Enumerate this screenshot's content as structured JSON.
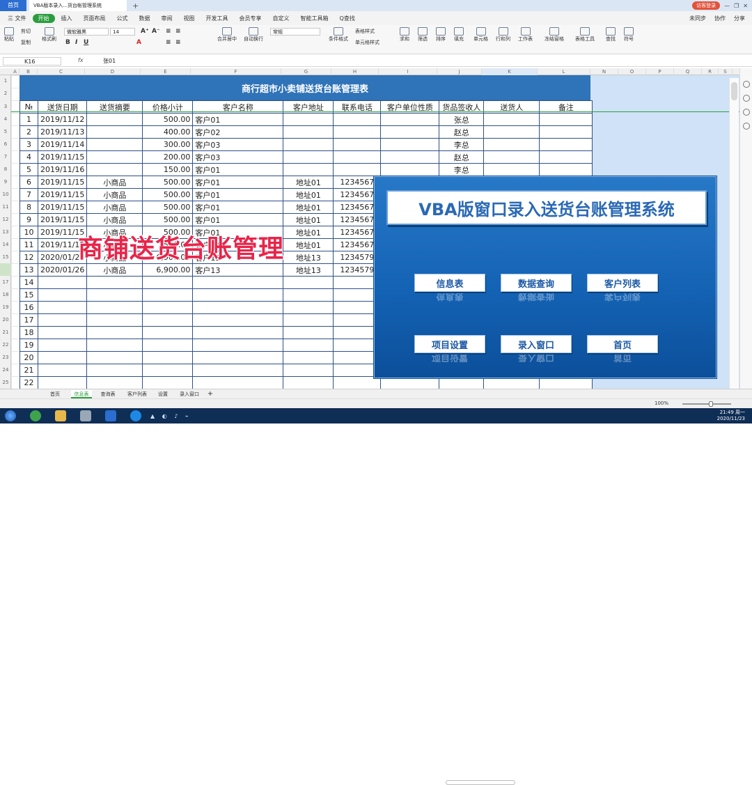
{
  "tabs": {
    "home": "首页",
    "document": "VBA版本录入...货台帐管理系统"
  },
  "login": "访客登录",
  "menu": {
    "file": "三 文件",
    "items": [
      "开始",
      "插入",
      "页面布局",
      "公式",
      "数据",
      "审阅",
      "视图",
      "开发工具",
      "会员专享",
      "自定义",
      "智能工具箱"
    ],
    "search": "Q查找",
    "right": [
      "未同步",
      "协作",
      "分享"
    ]
  },
  "ribbon": {
    "cut": "剪切",
    "paste": "粘贴",
    "copy": "复制",
    "format_painter": "格式刷",
    "font_name": "微软雅黑",
    "font_size": "14",
    "number_format": "常规",
    "merge": "合并居中",
    "wrap": "自动换行",
    "table_style": "表格样式",
    "cond_format": "条件格式",
    "cell_style": "单元格样式",
    "sum": "求和",
    "filter": "筛选",
    "sort": "排序",
    "fill": "填充",
    "cell": "单元格",
    "rowcol": "行和列",
    "worksheet": "工作表",
    "freeze": "冻结窗格",
    "table_tools": "表格工具",
    "find": "查找",
    "symbol": "符号"
  },
  "formula": {
    "cell_ref": "K16",
    "fx": "fx",
    "value": "张01"
  },
  "columns": [
    "A",
    "B",
    "C",
    "D",
    "E",
    "F",
    "G",
    "H",
    "I",
    "J",
    "K",
    "L",
    "N",
    "O",
    "P",
    "Q",
    "R",
    "S"
  ],
  "rows": [
    "1",
    "2",
    "3",
    "4",
    "5",
    "6",
    "7",
    "8",
    "9",
    "10",
    "11",
    "12",
    "13",
    "14",
    "15",
    "16",
    "17",
    "18",
    "19",
    "20",
    "21",
    "22",
    "23",
    "24",
    "25"
  ],
  "sheet": {
    "title": "商行超市小卖铺送货台账管理表",
    "headers": [
      "№",
      "送货日期",
      "送货摘要",
      "价格小计",
      "客户名称",
      "客户地址",
      "联系电话",
      "客户单位性质",
      "货品签收人",
      "送货人",
      "备注"
    ],
    "rows": [
      [
        "1",
        "2019/11/12",
        "",
        "500.00",
        "客户01",
        "",
        "",
        "",
        "张总",
        "",
        ""
      ],
      [
        "2",
        "2019/11/13",
        "",
        "400.00",
        "客户02",
        "",
        "",
        "",
        "赵总",
        "",
        ""
      ],
      [
        "3",
        "2019/11/14",
        "",
        "300.00",
        "客户03",
        "",
        "",
        "",
        "李总",
        "",
        ""
      ],
      [
        "4",
        "2019/11/15",
        "",
        "200.00",
        "客户03",
        "",
        "",
        "",
        "赵总",
        "",
        ""
      ],
      [
        "5",
        "2019/11/16",
        "",
        "150.00",
        "客户01",
        "",
        "",
        "",
        "李总",
        "",
        ""
      ],
      [
        "6",
        "2019/11/15",
        "小商品",
        "500.00",
        "客户01",
        "地址01",
        "1234567",
        "",
        "",
        "",
        ""
      ],
      [
        "7",
        "2019/11/15",
        "小商品",
        "500.00",
        "客户01",
        "地址01",
        "1234567",
        "",
        "",
        "",
        ""
      ],
      [
        "8",
        "2019/11/15",
        "小商品",
        "500.00",
        "客户01",
        "地址01",
        "1234567",
        "",
        "",
        "",
        ""
      ],
      [
        "9",
        "2019/11/15",
        "小商品",
        "500.00",
        "客户01",
        "地址01",
        "1234567",
        "",
        "",
        "",
        ""
      ],
      [
        "10",
        "2019/11/15",
        "小商品",
        "500.00",
        "客户01",
        "地址01",
        "1234567",
        "",
        "",
        "",
        ""
      ],
      [
        "11",
        "2019/11/15",
        "小商品",
        "500.00",
        "客户01",
        "地址01",
        "1234567",
        "",
        "",
        "",
        ""
      ],
      [
        "12",
        "2020/01/26",
        "小商品",
        "6,900.00",
        "客户13",
        "地址13",
        "1234579",
        "",
        "",
        "",
        ""
      ],
      [
        "13",
        "2020/01/26",
        "小商品",
        "6,900.00",
        "客户13",
        "地址13",
        "1234579",
        "",
        "",
        "",
        ""
      ],
      [
        "14",
        "",
        "",
        "",
        "",
        "",
        "",
        "",
        "",
        "",
        ""
      ],
      [
        "15",
        "",
        "",
        "",
        "",
        "",
        "",
        "",
        "",
        "",
        ""
      ],
      [
        "16",
        "",
        "",
        "",
        "",
        "",
        "",
        "",
        "",
        "",
        ""
      ],
      [
        "17",
        "",
        "",
        "",
        "",
        "",
        "",
        "",
        "",
        "",
        ""
      ],
      [
        "18",
        "",
        "",
        "",
        "",
        "",
        "",
        "",
        "",
        "",
        ""
      ],
      [
        "19",
        "",
        "",
        "",
        "",
        "",
        "",
        "",
        "",
        "",
        ""
      ],
      [
        "20",
        "",
        "",
        "",
        "",
        "",
        "",
        "",
        "",
        "",
        ""
      ],
      [
        "21",
        "",
        "",
        "",
        "",
        "",
        "",
        "",
        "",
        "",
        ""
      ],
      [
        "22",
        "",
        "",
        "",
        "",
        "",
        "",
        "",
        "",
        "",
        ""
      ]
    ]
  },
  "popup": {
    "title": "VBA版窗口录入送货台账管理系统",
    "buttons": [
      "信息表",
      "数据查询",
      "客户列表",
      "项目设置",
      "录入窗口",
      "首页"
    ]
  },
  "overlay_caption": "商铺送货台账管理",
  "sheet_tabs": [
    "首页",
    "信息表",
    "查询表",
    "客户列表",
    "设置",
    "录入窗口",
    "+"
  ],
  "active_sheet_tab": "信息表",
  "zoom": "100%",
  "clock": {
    "time": "21:49 周一",
    "date": "2020/11/23"
  },
  "colors": {
    "title_blue": "#2f73b8",
    "popup_blue": "#1463b5",
    "caption_red": "#e8254a",
    "accent_green": "#2a9d3d"
  }
}
